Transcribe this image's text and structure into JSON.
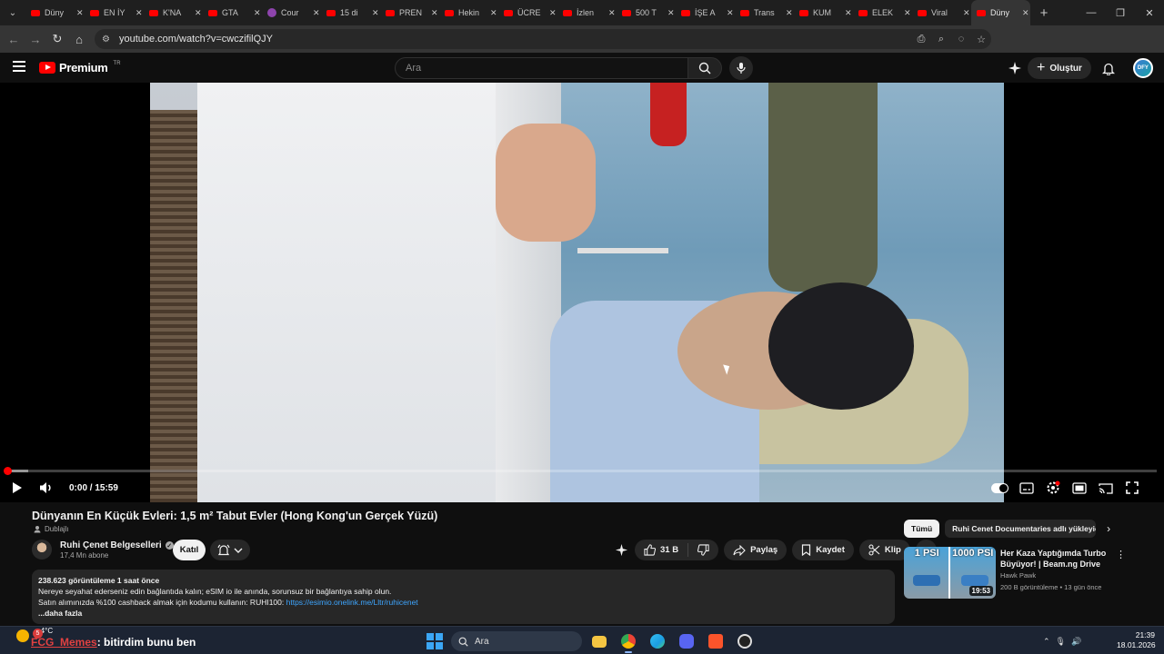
{
  "browser": {
    "tabs": [
      {
        "label": "Düny",
        "icon": "youtube-icon"
      },
      {
        "label": "EN İY",
        "icon": "youtube-icon"
      },
      {
        "label": "K'NA",
        "icon": "youtube-icon"
      },
      {
        "label": "GTA",
        "icon": "youtube-icon"
      },
      {
        "label": "Cour",
        "icon": "udemy-icon"
      },
      {
        "label": "15 di",
        "icon": "youtube-icon"
      },
      {
        "label": "PREN",
        "icon": "youtube-icon"
      },
      {
        "label": "Hekin",
        "icon": "youtube-icon"
      },
      {
        "label": "ÜCRE",
        "icon": "youtube-icon"
      },
      {
        "label": "İzlen",
        "icon": "youtube-icon"
      },
      {
        "label": "500 T",
        "icon": "youtube-icon"
      },
      {
        "label": "İŞE A",
        "icon": "youtube-icon"
      },
      {
        "label": "Trans",
        "icon": "youtube-icon"
      },
      {
        "label": "KUM",
        "icon": "youtube-icon"
      },
      {
        "label": "ELEK",
        "icon": "youtube-icon"
      },
      {
        "label": "Viral",
        "icon": "youtube-icon"
      },
      {
        "label": "Düny",
        "icon": "youtube-icon",
        "active": true
      }
    ],
    "tab_close": "✕",
    "new_tab": "+",
    "url": "youtube.com/watch?v=cwczifilQJY"
  },
  "youtube": {
    "logo_text": "Premium",
    "logo_region": "TR",
    "search_placeholder": "Ara",
    "create_label": "Oluştur",
    "avatar_text": "DFY"
  },
  "player": {
    "time": "0:00 / 15:59",
    "progress": 0.0,
    "buffered": 0.018
  },
  "video": {
    "title": "Dünyanın En Küçük Evleri: 1,5 m² Tabut Evler (Hong Kong'un Gerçek Yüzü)",
    "dubbed_label": "Dublajlı",
    "channel_name": "Ruhi Çenet Belgeselleri",
    "subscribers": "17,4 Mn abone",
    "join_label": "Katıl",
    "likes": "31 B",
    "share_label": "Paylaş",
    "save_label": "Kaydet",
    "clip_label": "Klip"
  },
  "description": {
    "stats": "238.623 görüntüleme  1 saat önce",
    "line1": "Nereye seyahat ederseniz edin bağlantıda kalın; eSIM io ile anında, sorunsuz bir bağlantıya sahip olun.",
    "line2_prefix": "Satın alımınızda %100 cashback almak için kodumu kullanın: RUHI100: ",
    "line2_link": "https://esimio.onelink.me/Lltr/ruhicenet",
    "more": "...daha fazla"
  },
  "sidebar": {
    "chips": [
      "Tümü",
      "Ruhi Cenet Documentaries adlı yükleyiciden"
    ],
    "recommendation": {
      "title": "Her Kaza Yaptığımda Turbo Büyüyor! | Beam.ng Drive",
      "channel": "Hawk Pawk",
      "meta": "200 B görüntüleme • 13 gün önce",
      "duration": "19:53",
      "thumb_left": "1 PSI",
      "thumb_right": "1000 PSI"
    }
  },
  "taskbar": {
    "weather_temp": "-4°C",
    "weather_badge": "5",
    "ticker_user": "FCG_Memes",
    "ticker_text": ": bitirdim bunu ben",
    "search_label": "Ara",
    "time": "21:39",
    "date": "18.01.2026"
  },
  "colors": {
    "youtube_red": "#ff0000",
    "link_blue": "#3ea6ff",
    "page_bg": "#0f0f0f"
  }
}
